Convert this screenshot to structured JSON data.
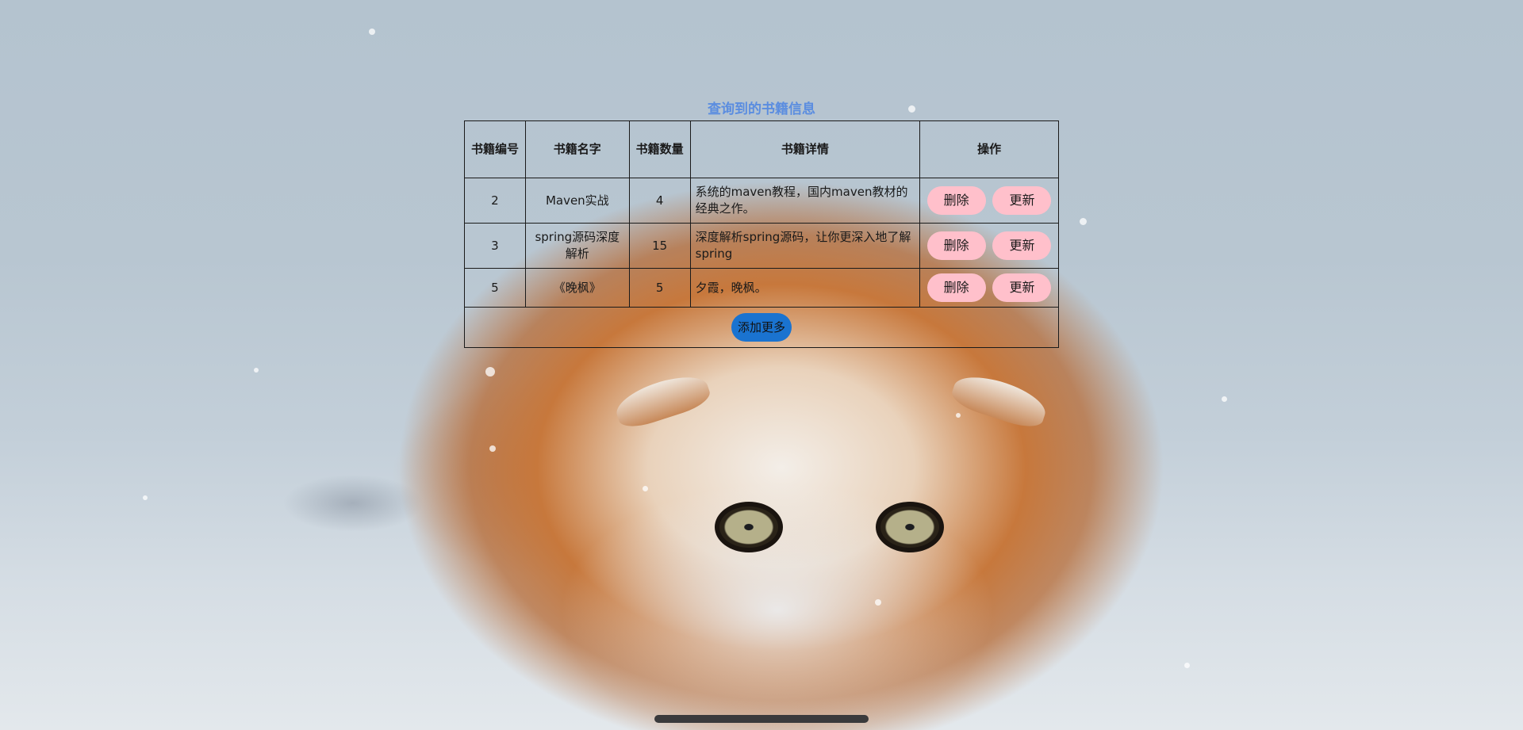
{
  "page": {
    "title": "查询到的书籍信息"
  },
  "table": {
    "headers": {
      "id": "书籍编号",
      "name": "书籍名字",
      "quantity": "书籍数量",
      "detail": "书籍详情",
      "operation": "操作"
    },
    "rows": [
      {
        "id": "2",
        "name": "Maven实战",
        "quantity": "4",
        "detail": "系统的maven教程，国内maven教材的经典之作。",
        "delete_label": "删除",
        "update_label": "更新"
      },
      {
        "id": "3",
        "name": "spring源码深度解析",
        "quantity": "15",
        "detail": "深度解析spring源码，让你更深入地了解spring",
        "delete_label": "删除",
        "update_label": "更新"
      },
      {
        "id": "5",
        "name": "《晚枫》",
        "quantity": "5",
        "detail": "夕霞，晚枫。",
        "delete_label": "删除",
        "update_label": "更新"
      }
    ],
    "add_more_label": "添加更多"
  },
  "colors": {
    "title": "#5b8de0",
    "action_button": "#ffc0cb",
    "add_button": "#1a73d0",
    "border": "#1a1a1a"
  },
  "background": {
    "icon": "cat-in-snow-photo"
  }
}
